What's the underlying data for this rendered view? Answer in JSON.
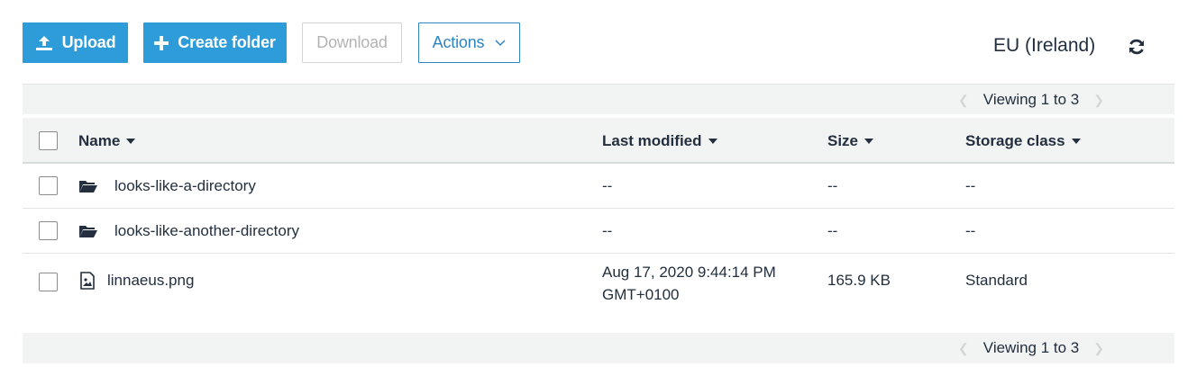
{
  "toolbar": {
    "upload_label": "Upload",
    "create_folder_label": "Create folder",
    "download_label": "Download",
    "actions_label": "Actions"
  },
  "region": "EU (Ireland)",
  "pager": {
    "label": "Viewing 1 to 3"
  },
  "columns": {
    "name": "Name",
    "last_modified": "Last modified",
    "size": "Size",
    "storage_class": "Storage class"
  },
  "rows": [
    {
      "type": "folder",
      "name": "looks-like-a-directory",
      "last_modified": "--",
      "size": "--",
      "storage_class": "--"
    },
    {
      "type": "folder",
      "name": "looks-like-another-directory",
      "last_modified": "--",
      "size": "--",
      "storage_class": "--"
    },
    {
      "type": "file",
      "name": "linnaeus.png",
      "last_modified_line1": "Aug 17, 2020 9:44:14 PM",
      "last_modified_line2": "GMT+0100",
      "size": "165.9 KB",
      "storage_class": "Standard"
    }
  ],
  "icons": {
    "upload": "upload-icon",
    "create_folder": "plus-icon",
    "actions": "chevron-down-icon",
    "refresh": "refresh-icon",
    "folder": "folder-open-icon",
    "file": "image-file-icon"
  },
  "colors": {
    "primary": "#2e9cd9",
    "actions_border": "#2e86c1",
    "text": "#232f3e",
    "stripe": "#f2f3f3"
  }
}
